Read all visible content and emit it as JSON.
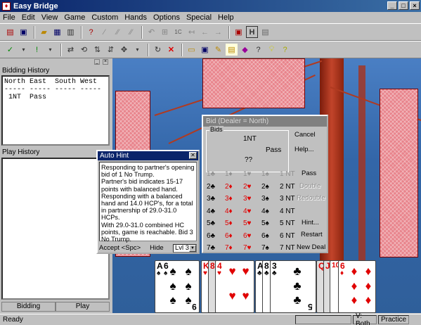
{
  "window": {
    "title": "Easy Bridge",
    "controls": [
      "_",
      "□",
      "×"
    ]
  },
  "menu": [
    "File",
    "Edit",
    "View",
    "Game",
    "Custom",
    "Hands",
    "Options",
    "Special",
    "Help"
  ],
  "left_panel": {
    "bidding_history_label": "Bidding History",
    "bidding_history_text": "North East  South West\n----- ----- ----- -----\n 1NT  Pass",
    "play_history_label": "Play History",
    "tabs": [
      "Bidding",
      "Play"
    ]
  },
  "auto_hint": {
    "title": "Auto Hint",
    "text": "Responding to partner's opening bid of 1 No Trump.\nPartner's bid indicates 15-17 points with balanced hand.\nResponding with a  balanced hand and 14.0 HCP's, for a total in partnership of 29.0-31.0 HCPs.\nWith 29.0-31.0 combined HC points, game is reachable.  Bid 3 No Trump.",
    "accept_label": "Accept <Spc>",
    "hide_label": "Hide",
    "level": "Lvl 3"
  },
  "bid_dialog": {
    "title": "Bid  (Dealer = North)",
    "bids_label": "Bids",
    "bid_north": "1NT",
    "bid_east": "Pass",
    "bid_south": "??",
    "side_buttons": [
      "Cancel",
      "Help..."
    ],
    "rows": [
      [
        "1♣",
        "1♦",
        "1♥",
        "1♠",
        "1 NT"
      ],
      [
        "2♣",
        "2♦",
        "2♥",
        "2♠",
        "2 NT"
      ],
      [
        "3♣",
        "3♦",
        "3♥",
        "3♠",
        "3 NT"
      ],
      [
        "4♣",
        "4♦",
        "4♥",
        "4♠",
        "4 NT"
      ],
      [
        "5♣",
        "5♦",
        "5♥",
        "5♠",
        "5 NT"
      ],
      [
        "6♣",
        "6♦",
        "6♥",
        "6♠",
        "6 NT"
      ],
      [
        "7♣",
        "7♦",
        "7♥",
        "7♠",
        "7 NT"
      ]
    ],
    "action_buttons": [
      "Pass",
      "Double",
      "Redouble",
      "Hint...",
      "Restart",
      "New Deal"
    ]
  },
  "hand": [
    {
      "rank": "A",
      "suit": "♠",
      "color": "black"
    },
    {
      "rank": "6",
      "suit": "♠",
      "color": "black"
    },
    {
      "rank": "9",
      "suit": "♠",
      "color": "black"
    },
    {
      "rank": "K",
      "suit": "♥",
      "color": "red"
    },
    {
      "rank": "8",
      "suit": "♥",
      "color": "red"
    },
    {
      "rank": "4",
      "suit": "♥",
      "color": "red"
    },
    {
      "rank": "A",
      "suit": "♣",
      "color": "black"
    },
    {
      "rank": "8",
      "suit": "♣",
      "color": "black"
    },
    {
      "rank": "3",
      "suit": "♣",
      "color": "black"
    },
    {
      "rank": "5",
      "suit": "♣",
      "color": "black"
    },
    {
      "rank": "Q",
      "suit": "♦",
      "color": "red"
    },
    {
      "rank": "J",
      "suit": "♦",
      "color": "red"
    },
    {
      "rank": "10",
      "suit": "♦",
      "color": "red"
    },
    {
      "rank": "6",
      "suit": "♦",
      "color": "red"
    }
  ],
  "status": {
    "text": "Ready",
    "mode": "V: Both",
    "practice": "Practice"
  },
  "colors": {
    "red_suit": "#e00000",
    "card_back": "#e8848c",
    "titlebar": "#0a246a"
  }
}
